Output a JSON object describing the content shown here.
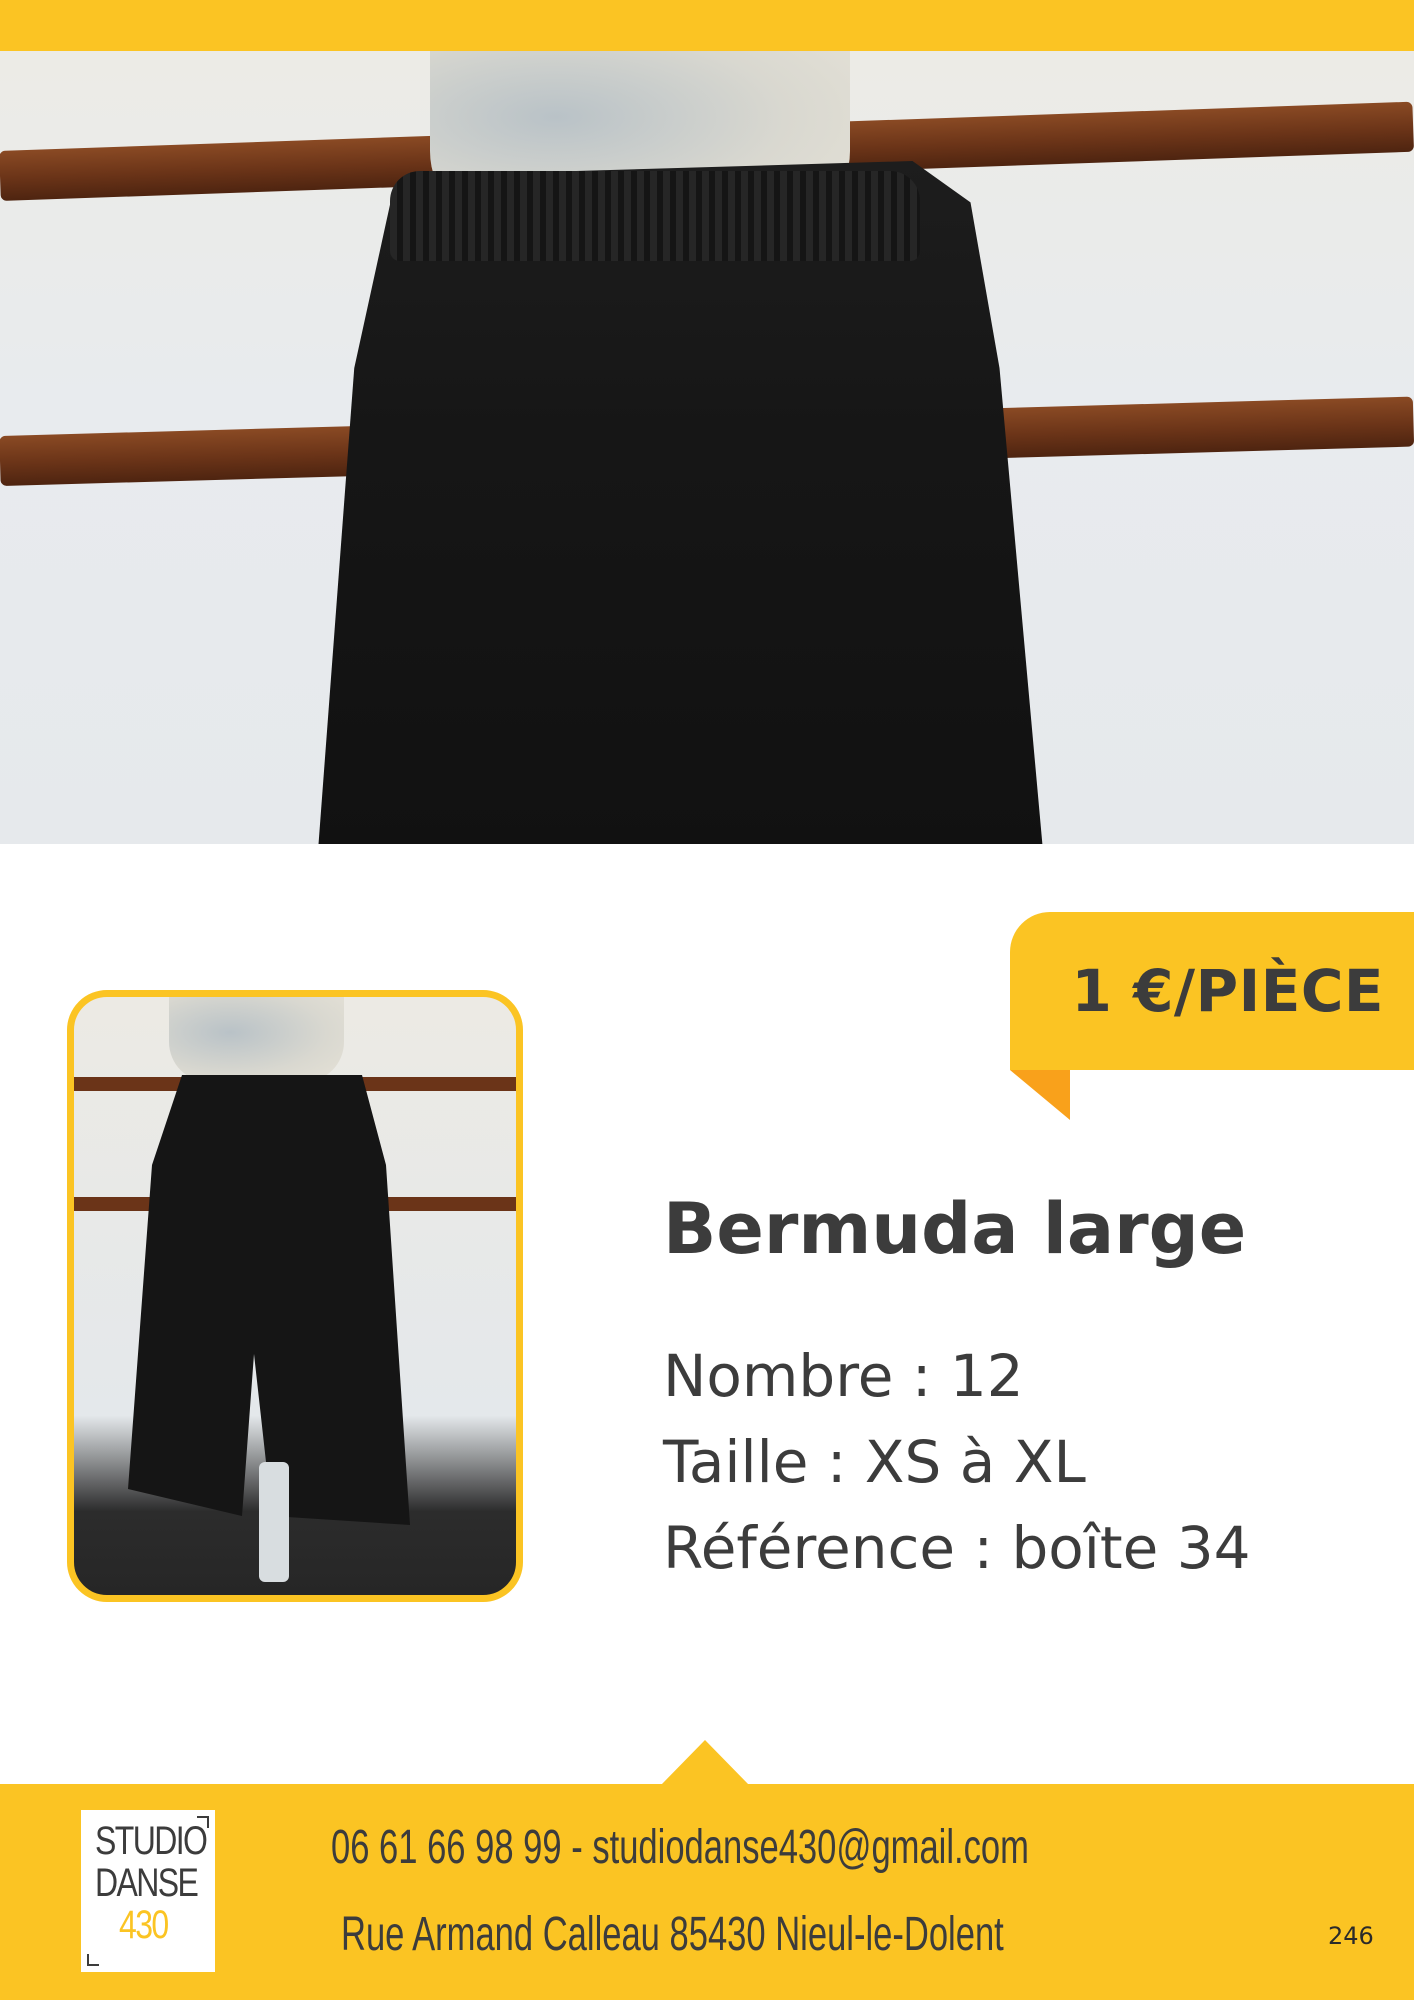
{
  "product": {
    "price_label": "1 €/PIÈCE",
    "title": "Bermuda large",
    "count_line": "Nombre : 12",
    "size_line": "Taille : XS à XL",
    "reference_line": "Référence : boîte 34"
  },
  "footer": {
    "logo_lines": [
      "STUDIO",
      "DANSE",
      "430"
    ],
    "contact_line": "06 61 66 98 99 - studiodanse430@gmail.com",
    "address_line": "Rue Armand Calleau 85430 Nieul-le-Dolent",
    "page_number": "246"
  },
  "colors": {
    "accent": "#fbc423",
    "fold": "#f9a11b",
    "text": "#3c3c3c"
  }
}
